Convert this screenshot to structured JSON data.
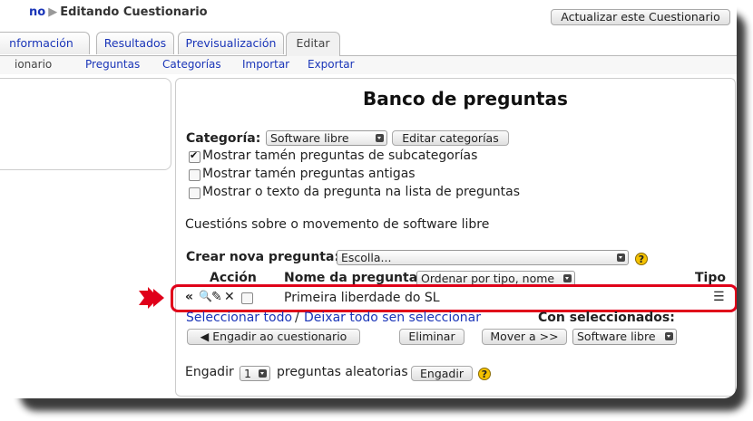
{
  "breadcrumb": {
    "link": "no",
    "separator": "▶",
    "current": "Editando Cuestionario"
  },
  "update_button": "Actualizar este Cuestionario",
  "tabs": [
    {
      "label": "nformación"
    },
    {
      "label": "Resultados"
    },
    {
      "label": "Previsualización"
    },
    {
      "label": "Editar"
    }
  ],
  "subtabs": [
    {
      "label": "ionario"
    },
    {
      "label": "Preguntas"
    },
    {
      "label": "Categorías"
    },
    {
      "label": "Importar"
    },
    {
      "label": "Exportar"
    }
  ],
  "main": {
    "title": "Banco de preguntas",
    "category_label": "Categoría:",
    "category_value": "Software libre",
    "edit_categories": "Editar categorías",
    "options": [
      {
        "label": "Mostrar tamén preguntas de subcategorías",
        "checked": true
      },
      {
        "label": "Mostrar tamén preguntas antigas",
        "checked": false
      },
      {
        "label": "Mostrar o texto da pregunta na lista de preguntas",
        "checked": false
      }
    ],
    "description": "Cuestións sobre o movemento de software libre",
    "create_label": "Crear nova pregunta:",
    "create_value": "Escolla...",
    "help": "?",
    "table": {
      "col_action": "Acción",
      "col_name": "Nome da pregunta",
      "sort_value": "Ordenar por tipo, nome",
      "col_type": "Tipo",
      "rows": [
        {
          "actions": "«🔍✎✕",
          "name": "Primeira liberdade do SL",
          "type_icon": "multichoice-icon"
        }
      ]
    },
    "select_all": "Seleccionar todo",
    "slash": "/",
    "deselect_all": "Deixar todo sen seleccionar",
    "with_selected": "Con seleccionados:",
    "add_to_quiz": "◀ Engadir ao cuestionario",
    "delete": "Eliminar",
    "move_to": "Mover a >>",
    "move_target": "Software libre",
    "add_label": "Engadir",
    "random_count": "1",
    "random_label": "preguntas aleatorias",
    "add_button": "Engadir"
  },
  "colors": {
    "highlight": "#e0001a",
    "link": "#1a35b8",
    "help": "#f5c200"
  }
}
